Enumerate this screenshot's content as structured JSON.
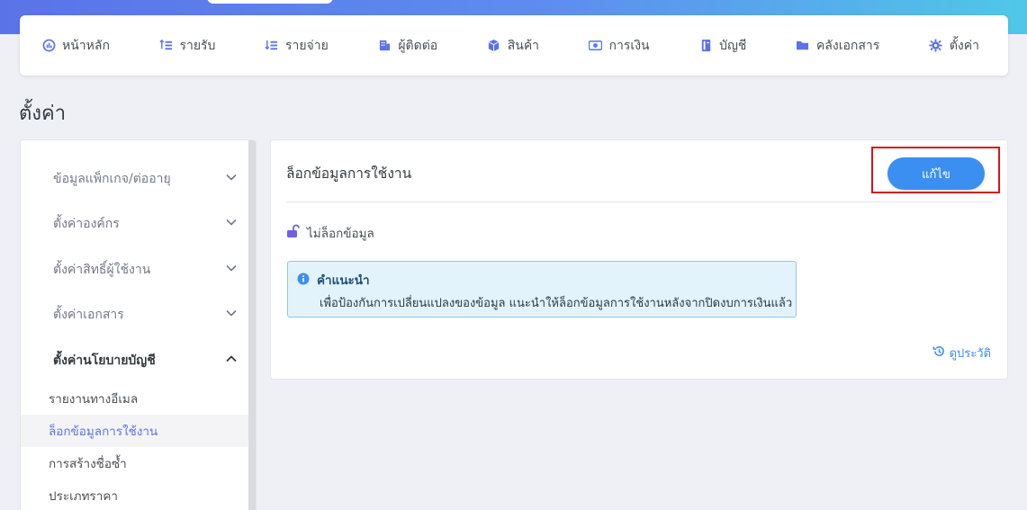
{
  "colors": {
    "accent": "#3b8ff0",
    "nav_icon": "#5b73e8",
    "highlight": "#d9151b",
    "alert_bg": "#e3f3fb"
  },
  "nav": {
    "items": [
      {
        "label": "หน้าหลัก",
        "icon": "dashboard-icon"
      },
      {
        "label": "รายรับ",
        "icon": "income-icon"
      },
      {
        "label": "รายจ่าย",
        "icon": "expense-icon"
      },
      {
        "label": "ผู้ติดต่อ",
        "icon": "contacts-icon"
      },
      {
        "label": "สินค้า",
        "icon": "box-icon"
      },
      {
        "label": "การเงิน",
        "icon": "money-icon"
      },
      {
        "label": "บัญชี",
        "icon": "book-icon"
      },
      {
        "label": "คลังเอกสาร",
        "icon": "folder-icon"
      },
      {
        "label": "ตั้งค่า",
        "icon": "gear-icon"
      }
    ]
  },
  "page": {
    "title": "ตั้งค่า"
  },
  "sidebar": {
    "groups": [
      {
        "label": "ข้อมูลแพ็กเกจ/ต่ออายุ",
        "state": "collapsed"
      },
      {
        "label": "ตั้งค่าองค์กร",
        "state": "collapsed"
      },
      {
        "label": "ตั้งค่าสิทธิ์ผู้ใช้งาน",
        "state": "collapsed"
      },
      {
        "label": "ตั้งค่าเอกสาร",
        "state": "collapsed"
      },
      {
        "label": "ตั้งค่านโยบายบัญชี",
        "state": "expanded"
      }
    ],
    "sub_items": [
      {
        "label": "รายงานทางอีเมล"
      },
      {
        "label": "ล็อกข้อมูลการใช้งาน",
        "active": true
      },
      {
        "label": "การสร้างชื่อซ้ำ"
      },
      {
        "label": "ประเภทราคา"
      }
    ]
  },
  "card": {
    "title": "ล็อกข้อมูลการใช้งาน",
    "edit_label": "แก้ไข",
    "lock_status": "ไม่ล็อกข้อมูล",
    "alert": {
      "title": "คำแนะนำ",
      "body": "เพื่อป้องกันการเปลี่ยนแปลงของข้อมูล แนะนำให้ล็อกข้อมูลการใช้งานหลังจากปิดงบการเงินแล้ว"
    },
    "history_label": "ดูประวัติ"
  }
}
